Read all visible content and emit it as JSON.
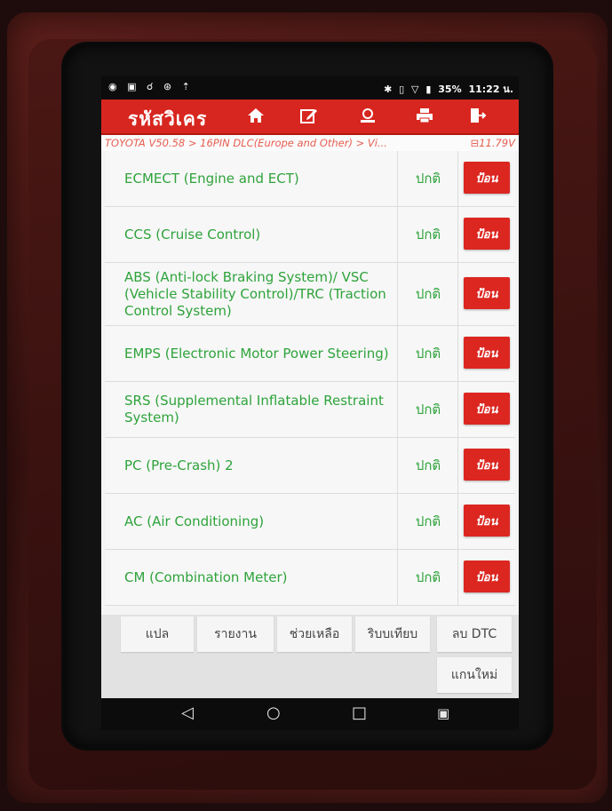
{
  "status_bar": {
    "left_icons": "◉ ▣ ☌ ⊛ ⇡",
    "battery": "35%",
    "time": "11:22 น."
  },
  "header": {
    "title": "รหัสวิเคร",
    "buttons": [
      "home-icon",
      "edit-icon",
      "profile-icon",
      "print-icon",
      "exit-icon"
    ]
  },
  "breadcrumb": {
    "path": "TOYOTA V50.58 > 16PIN DLC(Europe and Other) > Vi...",
    "voltage": "11.79V"
  },
  "systems": [
    {
      "name": "ECMECT (Engine and ECT)",
      "status": "ปกติ",
      "action": "ป้อน"
    },
    {
      "name": "CCS (Cruise Control)",
      "status": "ปกติ",
      "action": "ป้อน"
    },
    {
      "name": "ABS (Anti-lock Braking System)/ VSC (Vehicle Stability Control)/TRC (Traction Control System)",
      "status": "ปกติ",
      "action": "ป้อน"
    },
    {
      "name": "EMPS (Electronic Motor Power Steering)",
      "status": "ปกติ",
      "action": "ป้อน"
    },
    {
      "name": "SRS (Supplemental Inflatable Restraint System)",
      "status": "ปกติ",
      "action": "ป้อน"
    },
    {
      "name": "PC (Pre-Crash) 2",
      "status": "ปกติ",
      "action": "ป้อน"
    },
    {
      "name": "AC (Air Conditioning)",
      "status": "ปกติ",
      "action": "ป้อน"
    },
    {
      "name": "CM (Combination Meter)",
      "status": "ปกติ",
      "action": "ป้อน"
    }
  ],
  "bottom_toolbar": {
    "translate": "แปล",
    "report": "รายงาน",
    "help": "ช่วยเหลือ",
    "compare": "ริบบเทียบ",
    "clear_dtc": "ลบ DTC",
    "rescan": "แกนใหม่"
  },
  "colors": {
    "accent": "#d7261f",
    "text_green": "#2ea33b",
    "breadcrumb": "#e65d4f"
  }
}
